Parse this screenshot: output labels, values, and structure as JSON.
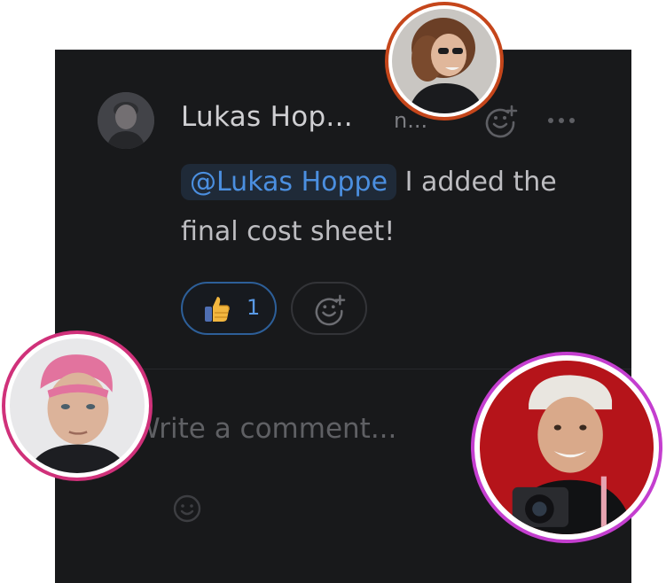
{
  "comment": {
    "author_name": "Lukas Hop...",
    "timestamp": "n...",
    "mention": "@Lukas Hoppe",
    "text": " I added the final cost sheet!",
    "reactions": [
      {
        "emoji_icon": "thumbs-up-icon",
        "count": "1"
      }
    ]
  },
  "composer": {
    "placeholder": "Write a comment..."
  },
  "colors": {
    "panel_bg": "#18191b",
    "mention_text": "#4b8fe0",
    "mention_bg": "#1f2a38",
    "reaction_border": "#2d5f99",
    "avatar_ring_orange": "#c5461b",
    "avatar_ring_pink": "#d0317a",
    "avatar_ring_magenta": "#c43ecf"
  }
}
